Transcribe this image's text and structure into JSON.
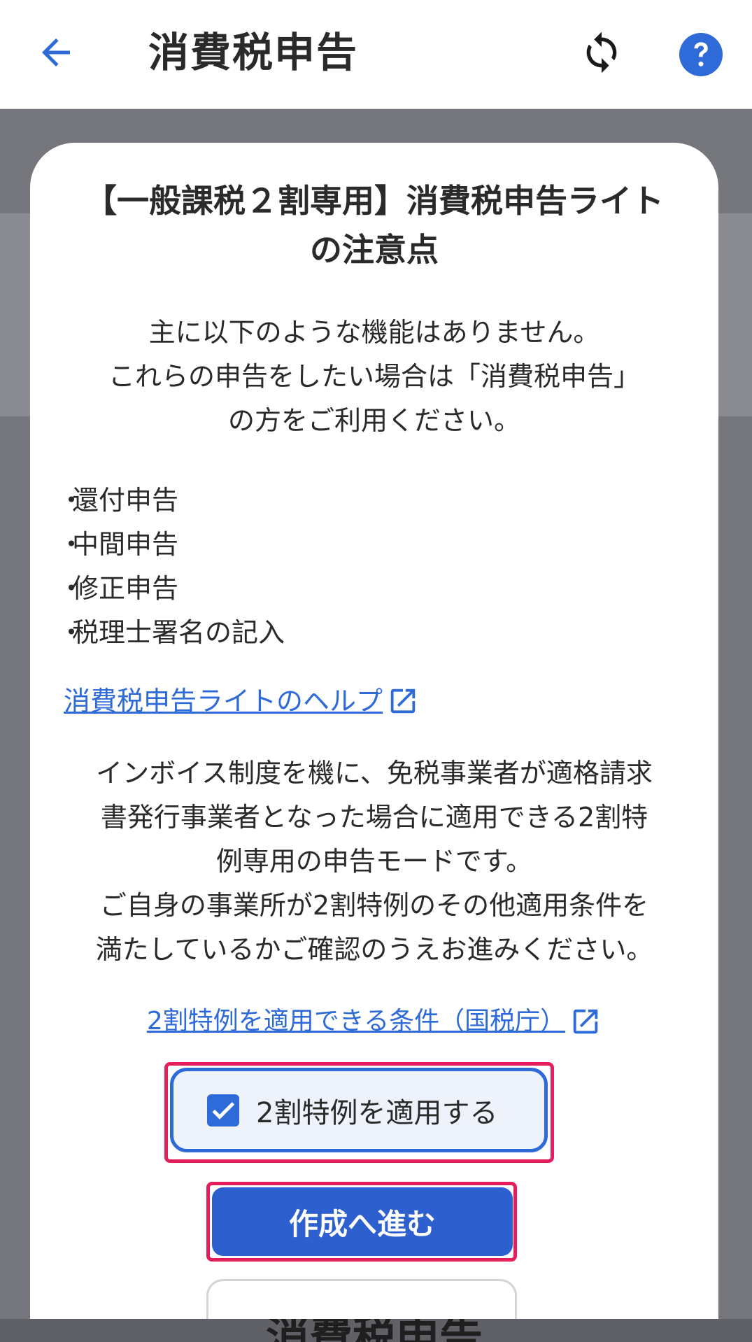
{
  "appbar": {
    "title": "消費税申告",
    "back_icon": "arrow-left-icon",
    "sync_icon": "sync-icon",
    "help_icon": "help-circle-icon"
  },
  "modal": {
    "title_line1": "【一般課税２割専用】消費税申告ライト",
    "title_line2": "の注意点",
    "intro_lines": [
      "主に以下のような機能はありません。",
      "これらの申告をしたい場合は「消費税申告」",
      "の方をご利用ください。"
    ],
    "features": [
      "還付申告",
      "中間申告",
      "修正申告",
      "税理士署名の記入"
    ],
    "help_link": "消費税申告ライトのヘルプ",
    "description_lines": [
      "インボイス制度を機に、免税事業者が適格請求",
      "書発行事業者となった場合に適用できる2割特",
      "例専用の申告モードです。",
      "ご自身の事業所が2割特例のその他適用条件を",
      "満たしているかご確認のうえお進みください。"
    ],
    "condition_link": "2割特例を適用できる条件（国税庁）",
    "checkbox_label": "2割特例を適用する",
    "checkbox_checked": true,
    "proceed_button": "作成へ進む",
    "secondary_button_peek": "消費税申告"
  },
  "colors": {
    "accent": "#2f6bd8",
    "primary_button": "#2d5fcf",
    "highlight": "#e41e5a",
    "overlay": "#75777d"
  }
}
